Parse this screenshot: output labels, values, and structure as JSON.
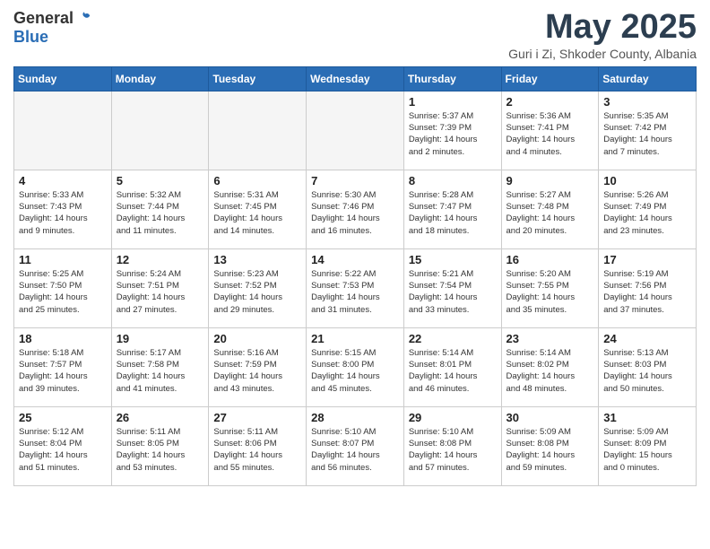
{
  "header": {
    "logo_general": "General",
    "logo_blue": "Blue",
    "month_title": "May 2025",
    "subtitle": "Guri i Zi, Shkoder County, Albania"
  },
  "weekdays": [
    "Sunday",
    "Monday",
    "Tuesday",
    "Wednesday",
    "Thursday",
    "Friday",
    "Saturday"
  ],
  "weeks": [
    [
      {
        "day": "",
        "info": ""
      },
      {
        "day": "",
        "info": ""
      },
      {
        "day": "",
        "info": ""
      },
      {
        "day": "",
        "info": ""
      },
      {
        "day": "1",
        "info": "Sunrise: 5:37 AM\nSunset: 7:39 PM\nDaylight: 14 hours\nand 2 minutes."
      },
      {
        "day": "2",
        "info": "Sunrise: 5:36 AM\nSunset: 7:41 PM\nDaylight: 14 hours\nand 4 minutes."
      },
      {
        "day": "3",
        "info": "Sunrise: 5:35 AM\nSunset: 7:42 PM\nDaylight: 14 hours\nand 7 minutes."
      }
    ],
    [
      {
        "day": "4",
        "info": "Sunrise: 5:33 AM\nSunset: 7:43 PM\nDaylight: 14 hours\nand 9 minutes."
      },
      {
        "day": "5",
        "info": "Sunrise: 5:32 AM\nSunset: 7:44 PM\nDaylight: 14 hours\nand 11 minutes."
      },
      {
        "day": "6",
        "info": "Sunrise: 5:31 AM\nSunset: 7:45 PM\nDaylight: 14 hours\nand 14 minutes."
      },
      {
        "day": "7",
        "info": "Sunrise: 5:30 AM\nSunset: 7:46 PM\nDaylight: 14 hours\nand 16 minutes."
      },
      {
        "day": "8",
        "info": "Sunrise: 5:28 AM\nSunset: 7:47 PM\nDaylight: 14 hours\nand 18 minutes."
      },
      {
        "day": "9",
        "info": "Sunrise: 5:27 AM\nSunset: 7:48 PM\nDaylight: 14 hours\nand 20 minutes."
      },
      {
        "day": "10",
        "info": "Sunrise: 5:26 AM\nSunset: 7:49 PM\nDaylight: 14 hours\nand 23 minutes."
      }
    ],
    [
      {
        "day": "11",
        "info": "Sunrise: 5:25 AM\nSunset: 7:50 PM\nDaylight: 14 hours\nand 25 minutes."
      },
      {
        "day": "12",
        "info": "Sunrise: 5:24 AM\nSunset: 7:51 PM\nDaylight: 14 hours\nand 27 minutes."
      },
      {
        "day": "13",
        "info": "Sunrise: 5:23 AM\nSunset: 7:52 PM\nDaylight: 14 hours\nand 29 minutes."
      },
      {
        "day": "14",
        "info": "Sunrise: 5:22 AM\nSunset: 7:53 PM\nDaylight: 14 hours\nand 31 minutes."
      },
      {
        "day": "15",
        "info": "Sunrise: 5:21 AM\nSunset: 7:54 PM\nDaylight: 14 hours\nand 33 minutes."
      },
      {
        "day": "16",
        "info": "Sunrise: 5:20 AM\nSunset: 7:55 PM\nDaylight: 14 hours\nand 35 minutes."
      },
      {
        "day": "17",
        "info": "Sunrise: 5:19 AM\nSunset: 7:56 PM\nDaylight: 14 hours\nand 37 minutes."
      }
    ],
    [
      {
        "day": "18",
        "info": "Sunrise: 5:18 AM\nSunset: 7:57 PM\nDaylight: 14 hours\nand 39 minutes."
      },
      {
        "day": "19",
        "info": "Sunrise: 5:17 AM\nSunset: 7:58 PM\nDaylight: 14 hours\nand 41 minutes."
      },
      {
        "day": "20",
        "info": "Sunrise: 5:16 AM\nSunset: 7:59 PM\nDaylight: 14 hours\nand 43 minutes."
      },
      {
        "day": "21",
        "info": "Sunrise: 5:15 AM\nSunset: 8:00 PM\nDaylight: 14 hours\nand 45 minutes."
      },
      {
        "day": "22",
        "info": "Sunrise: 5:14 AM\nSunset: 8:01 PM\nDaylight: 14 hours\nand 46 minutes."
      },
      {
        "day": "23",
        "info": "Sunrise: 5:14 AM\nSunset: 8:02 PM\nDaylight: 14 hours\nand 48 minutes."
      },
      {
        "day": "24",
        "info": "Sunrise: 5:13 AM\nSunset: 8:03 PM\nDaylight: 14 hours\nand 50 minutes."
      }
    ],
    [
      {
        "day": "25",
        "info": "Sunrise: 5:12 AM\nSunset: 8:04 PM\nDaylight: 14 hours\nand 51 minutes."
      },
      {
        "day": "26",
        "info": "Sunrise: 5:11 AM\nSunset: 8:05 PM\nDaylight: 14 hours\nand 53 minutes."
      },
      {
        "day": "27",
        "info": "Sunrise: 5:11 AM\nSunset: 8:06 PM\nDaylight: 14 hours\nand 55 minutes."
      },
      {
        "day": "28",
        "info": "Sunrise: 5:10 AM\nSunset: 8:07 PM\nDaylight: 14 hours\nand 56 minutes."
      },
      {
        "day": "29",
        "info": "Sunrise: 5:10 AM\nSunset: 8:08 PM\nDaylight: 14 hours\nand 57 minutes."
      },
      {
        "day": "30",
        "info": "Sunrise: 5:09 AM\nSunset: 8:08 PM\nDaylight: 14 hours\nand 59 minutes."
      },
      {
        "day": "31",
        "info": "Sunrise: 5:09 AM\nSunset: 8:09 PM\nDaylight: 15 hours\nand 0 minutes."
      }
    ]
  ]
}
